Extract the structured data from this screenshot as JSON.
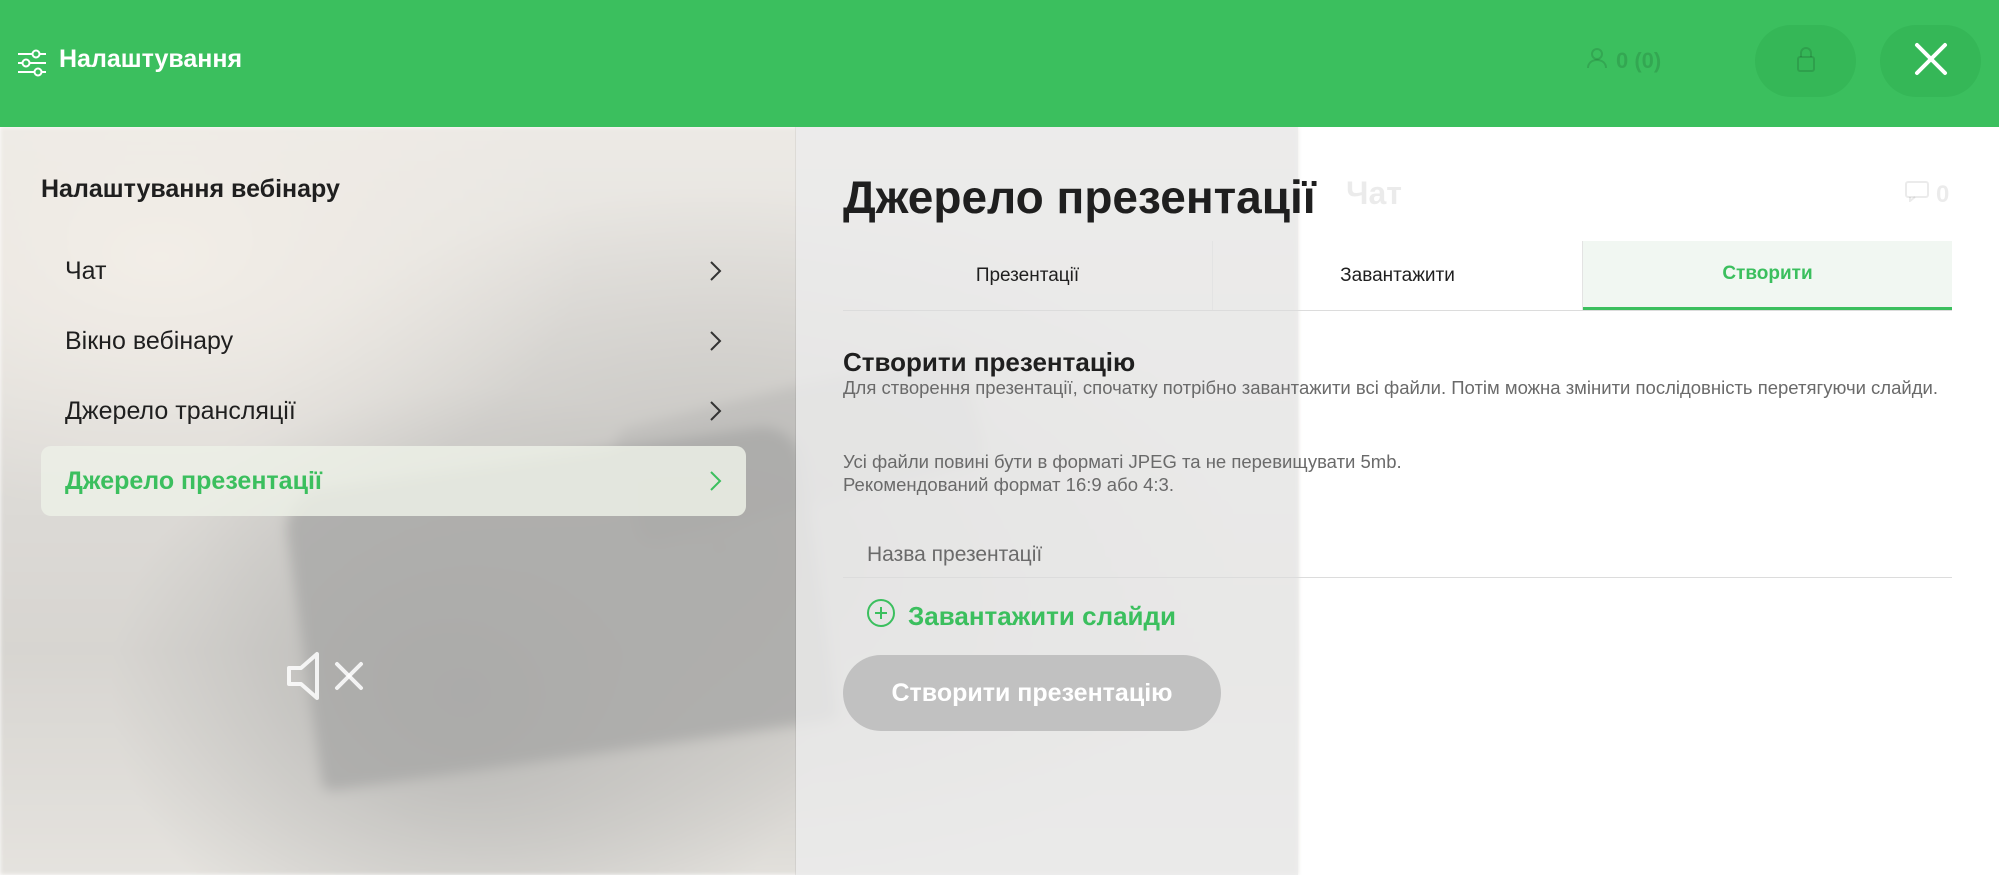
{
  "header": {
    "title": "Налаштування",
    "viewers": "0 (0)"
  },
  "left": {
    "title": "Налаштування вебінару",
    "menu": [
      {
        "label": "Чат"
      },
      {
        "label": "Вікно вебінару"
      },
      {
        "label": "Джерело трансляції"
      },
      {
        "label": "Джерело презентації",
        "active": true
      }
    ]
  },
  "background": {
    "chat_label": "Чат",
    "chat_count": "0"
  },
  "panel": {
    "title": "Джерело презентації",
    "tabs": [
      {
        "label": "Презентації"
      },
      {
        "label": "Завантажити"
      },
      {
        "label": "Створити",
        "active": true
      }
    ],
    "section_title": "Створити презентацію",
    "section_desc": "Для створення презентації, спочатку потрібно завантажити всі файли. Потім можна змінити послідовність перетягуючи слайди.",
    "rule1": "Усі файли повині бути в форматі JPEG та не перевищувати 5mb.",
    "rule2": "Рекомендований формат 16:9 або 4:3.",
    "name_placeholder": "Назва презентації",
    "upload_label": "Завантажити слайди",
    "create_label": "Створити презентацію"
  },
  "colors": {
    "accent": "#3bbf5e",
    "disabled": "#c1c1c1"
  }
}
